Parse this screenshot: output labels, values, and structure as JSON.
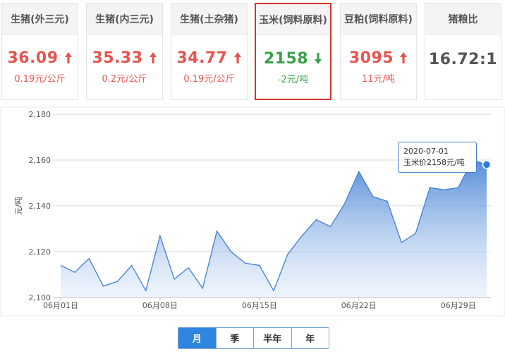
{
  "cards": [
    {
      "title": "生猪(外三元)",
      "price": "36.09",
      "change": "0.19元/公斤",
      "dir": "up"
    },
    {
      "title": "生猪(内三元)",
      "price": "35.33",
      "change": "0.2元/公斤",
      "dir": "up"
    },
    {
      "title": "生猪(土杂猪)",
      "price": "34.77",
      "change": "0.19元/公斤",
      "dir": "up"
    },
    {
      "title": "玉米(饲料原料)",
      "price": "2158",
      "change": "-2元/吨",
      "dir": "down"
    },
    {
      "title": "豆粕(饲料原料)",
      "price": "3095",
      "change": "11元/吨",
      "dir": "up"
    },
    {
      "title": "猪粮比",
      "price": "16.72:1",
      "change": "",
      "dir": "none"
    }
  ],
  "selected_card": "玉米(饲料原料)",
  "colors": {
    "up": "#e8544f",
    "down": "#3aa14b",
    "line": "#3f7fd1",
    "selected_border": "#d9302c",
    "active_period": "#2f86de"
  },
  "chart_data": {
    "type": "area",
    "ylabel": "元/吨",
    "ylim": [
      2100,
      2180
    ],
    "yticks": [
      "2,180",
      "2,160",
      "2,140",
      "2,120",
      "2,100"
    ],
    "xtick_labels": [
      "06月01日",
      "06月08日",
      "06月15日",
      "06月22日",
      "06月29日"
    ],
    "x": [
      "06-01",
      "06-02",
      "06-03",
      "06-04",
      "06-05",
      "06-06",
      "06-07",
      "06-08",
      "06-09",
      "06-10",
      "06-11",
      "06-12",
      "06-13",
      "06-14",
      "06-15",
      "06-16",
      "06-17",
      "06-18",
      "06-19",
      "06-20",
      "06-21",
      "06-22",
      "06-23",
      "06-24",
      "06-25",
      "06-26",
      "06-27",
      "06-28",
      "06-29",
      "06-30",
      "07-01"
    ],
    "values": [
      2114,
      2111,
      2117,
      2105,
      2107,
      2114,
      2103,
      2127,
      2108,
      2113,
      2104,
      2129,
      2120,
      2115,
      2114,
      2103,
      2119,
      2127,
      2134,
      2131,
      2141,
      2155,
      2144,
      2142,
      2124,
      2128,
      2148,
      2147,
      2148,
      2160,
      2158
    ],
    "grid": true,
    "tooltip": {
      "date": "2020-07-01",
      "label": "玉米价2158元/吨"
    }
  },
  "periods": [
    "月",
    "季",
    "半年",
    "年"
  ],
  "active_period": "月"
}
